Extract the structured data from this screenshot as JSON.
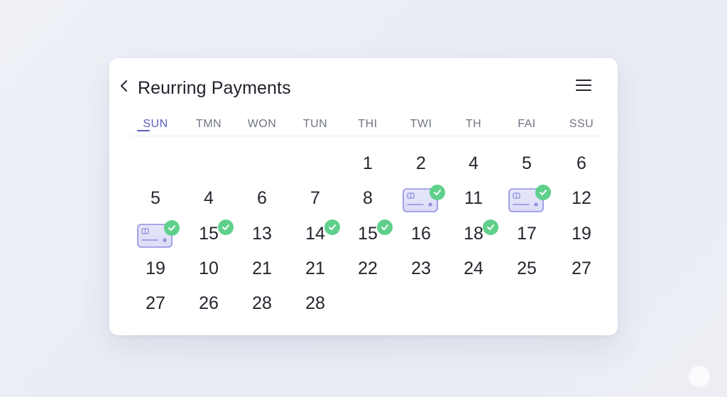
{
  "header": {
    "title": "Reurring Payments",
    "back_icon": "chevron-left-icon",
    "menu_icon": "hamburger-menu-icon"
  },
  "weekdays": [
    "SUN",
    "TMN",
    "WON",
    "TUN",
    "THI",
    "TWI",
    "TH",
    "FAI",
    "SSU"
  ],
  "active_weekday_index": 0,
  "colors": {
    "accent": "#5a5fbf",
    "check": "#5fd08b",
    "card_chip_fill": "#dcdcf6",
    "card_chip_stroke": "#8d8fe0",
    "text": "#23262e",
    "weekday_text": "#6f7482"
  },
  "rows": [
    [
      null,
      null,
      null,
      null,
      "1",
      "2",
      "4",
      "5",
      "6"
    ],
    [
      "5",
      "4",
      "6",
      "7",
      "8",
      null,
      "11",
      null,
      "12"
    ],
    [
      null,
      "15",
      "13",
      "14",
      "15",
      "16",
      "18",
      "17",
      "19"
    ],
    [
      "19",
      "10",
      "21",
      "21",
      "22",
      "23",
      "24",
      "25",
      "27"
    ],
    [
      "27",
      "26",
      "28",
      "28",
      null,
      null,
      null,
      null,
      null
    ]
  ],
  "payment_cards": [
    {
      "row": 1,
      "col": 5,
      "icon": "credit-card-icon",
      "paid": true
    },
    {
      "row": 1,
      "col": 7,
      "icon": "credit-card-icon",
      "paid": true
    },
    {
      "row": 2,
      "col": 0,
      "icon": "credit-card-icon",
      "paid": true
    }
  ],
  "paid_days": [
    {
      "row": 2,
      "col": 1
    },
    {
      "row": 2,
      "col": 3
    },
    {
      "row": 2,
      "col": 4
    },
    {
      "row": 2,
      "col": 6
    }
  ]
}
